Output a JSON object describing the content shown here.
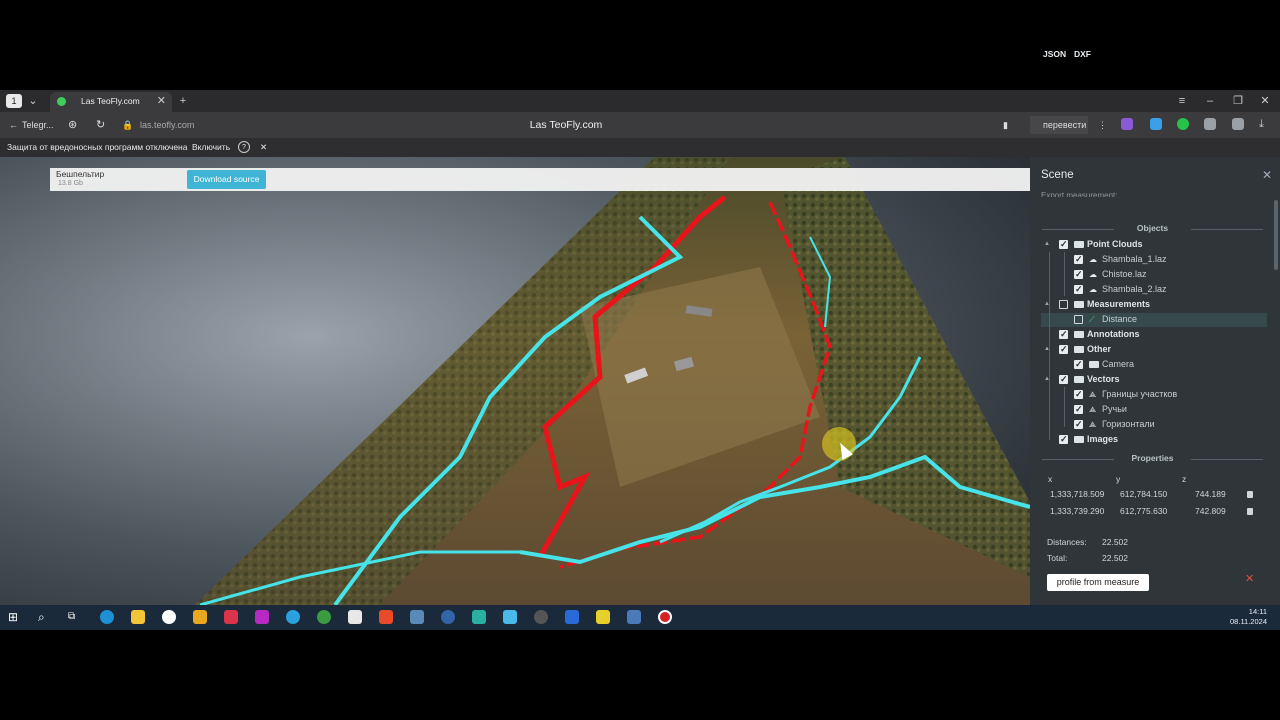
{
  "browser": {
    "tab_title": "Las TeoFly.com",
    "back_label": "Telegr...",
    "url": "las.teofly.com",
    "page_title": "Las TeoFly.com",
    "translate_label": "перевести"
  },
  "warning_bar": {
    "message": "Защита от вредоносных программ отключена",
    "enable_label": "Включить",
    "help_symbol": "?"
  },
  "download": {
    "name": "Бешпельтир",
    "size": "13.8 Gb",
    "button_label": "Download source"
  },
  "scene": {
    "title": "Scene",
    "export_label": "Export measurement:",
    "export_formats": [
      "JSON",
      "DXF"
    ],
    "objects_heading": "Objects",
    "tree": [
      {
        "label": "Point Clouds",
        "type": "group",
        "checked": true
      },
      {
        "label": "Shambala_1.laz",
        "type": "cloud",
        "checked": true
      },
      {
        "label": "Chistoe.laz",
        "type": "cloud",
        "checked": true
      },
      {
        "label": "Shambala_2.laz",
        "type": "cloud",
        "checked": true
      },
      {
        "label": "Measurements",
        "type": "group",
        "checked": false
      },
      {
        "label": "Distance",
        "type": "measure",
        "checked": false,
        "selected": true
      },
      {
        "label": "Annotations",
        "type": "group",
        "checked": true
      },
      {
        "label": "Other",
        "type": "group",
        "checked": true
      },
      {
        "label": "Camera",
        "type": "folder",
        "checked": true
      },
      {
        "label": "Vectors",
        "type": "group",
        "checked": true
      },
      {
        "label": "Границы участков",
        "type": "vector",
        "checked": true
      },
      {
        "label": "Ручьи",
        "type": "vector",
        "checked": true
      },
      {
        "label": "Горизонтали",
        "type": "vector",
        "checked": true
      },
      {
        "label": "Images",
        "type": "group",
        "checked": true
      }
    ],
    "properties_heading": "Properties",
    "columns": [
      "x",
      "y",
      "z"
    ],
    "points": [
      {
        "x": "1,333,718.509",
        "y": "612,784.150",
        "z": "744.189"
      },
      {
        "x": "1,333,739.290",
        "y": "612,775.630",
        "z": "742.809"
      }
    ],
    "distances_label": "Distances:",
    "distances_value": "22.502",
    "total_label": "Total:",
    "total_value": "22.502",
    "profile_button": "profile from measure",
    "remove_symbol": "✕"
  },
  "taskbar": {
    "time": "14:11",
    "date": "08.11.2024"
  },
  "colors": {
    "panel_bg": "#303539",
    "accent_download": "#3fb4d4",
    "boundary_line": "#e8141a",
    "stream_line": "#46e3e8"
  }
}
